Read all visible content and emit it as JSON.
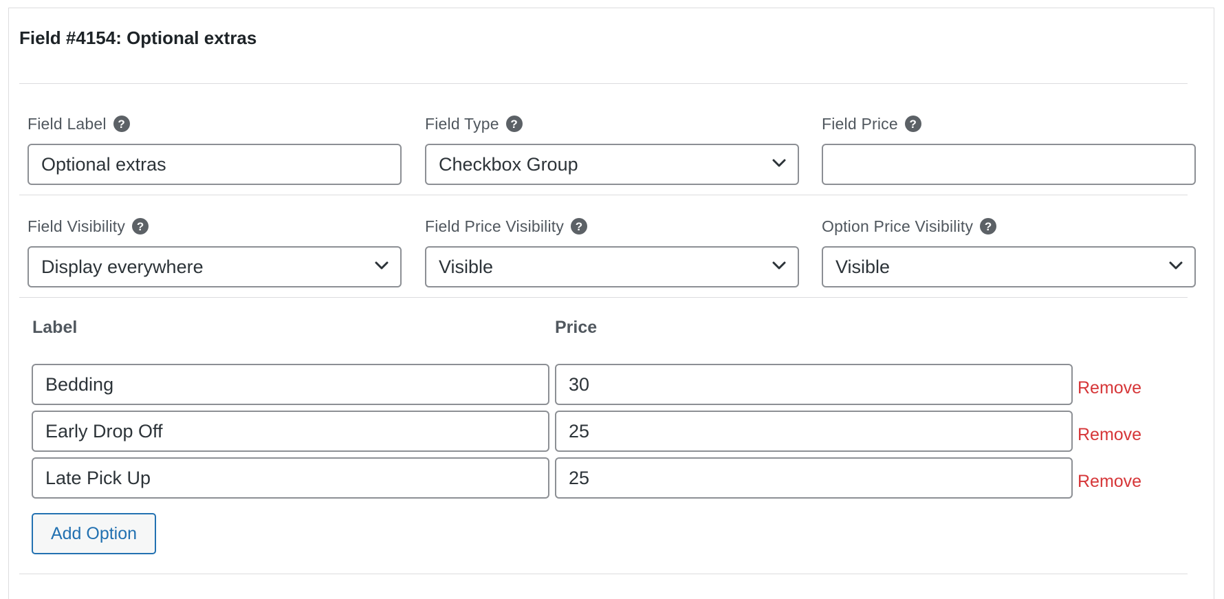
{
  "field": {
    "title": "Field #4154: Optional extras"
  },
  "settings": {
    "label": {
      "label": "Field Label",
      "value": "Optional extras"
    },
    "type": {
      "label": "Field Type",
      "selected": "Checkbox Group"
    },
    "price": {
      "label": "Field Price",
      "value": ""
    },
    "visibility": {
      "label": "Field Visibility",
      "selected": "Display everywhere"
    },
    "price_visibility": {
      "label": "Field Price Visibility",
      "selected": "Visible"
    },
    "option_price_visibility": {
      "label": "Option Price Visibility",
      "selected": "Visible"
    },
    "help_glyph": "?"
  },
  "options": {
    "headers": {
      "label": "Label",
      "price": "Price"
    },
    "rows": [
      {
        "label": "Bedding",
        "price": "30",
        "remove": "Remove"
      },
      {
        "label": "Early Drop Off",
        "price": "25",
        "remove": "Remove"
      },
      {
        "label": "Late Pick Up",
        "price": "25",
        "remove": "Remove"
      }
    ],
    "add_label": "Add Option"
  },
  "colors": {
    "accent": "#2271b1",
    "remove": "#d63638",
    "border": "#8c8f94",
    "help_icon_bg": "#5c6166"
  }
}
